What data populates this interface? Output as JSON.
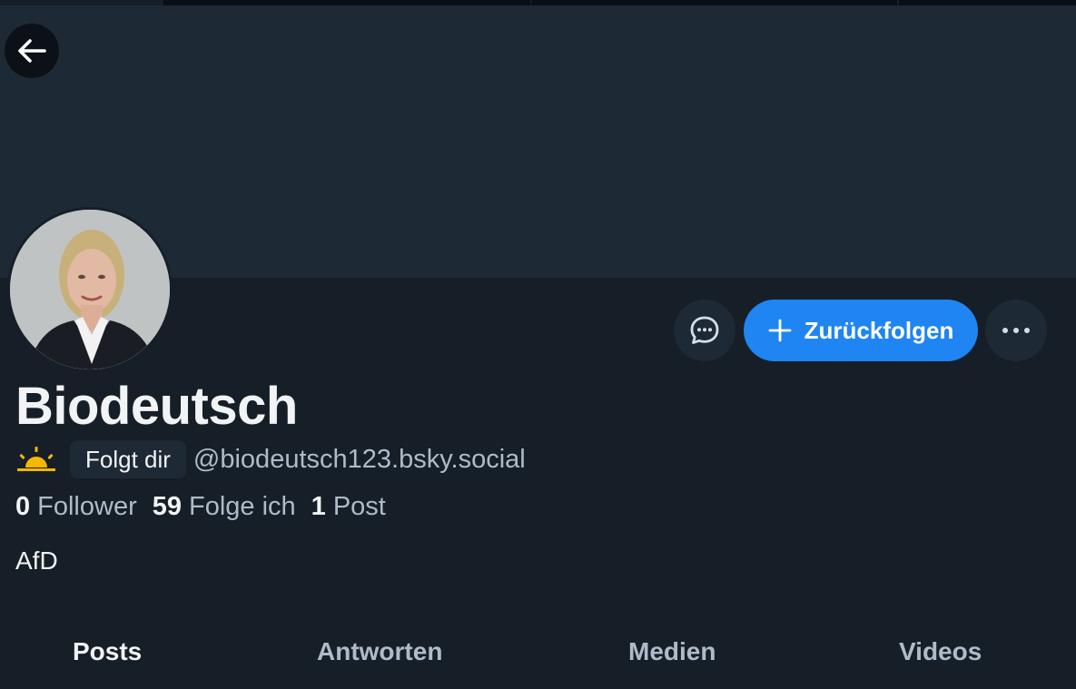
{
  "profile": {
    "display_name": "Biodeutsch",
    "handle": "@biodeutsch123.bsky.social",
    "follows_you_badge": "Folgt dir",
    "bio": "AfD"
  },
  "stats": {
    "followers_count": "0",
    "followers_label": "Follower",
    "following_count": "59",
    "following_label": "Folge ich",
    "posts_count": "1",
    "posts_label": "Post"
  },
  "actions": {
    "follow_back_label": "Zurückfolgen"
  },
  "tabs": [
    {
      "label": "Posts",
      "active": true
    },
    {
      "label": "Antworten",
      "active": false
    },
    {
      "label": "Medien",
      "active": false
    },
    {
      "label": "Videos",
      "active": false
    }
  ],
  "colors": {
    "background": "#161e27",
    "banner": "#1e2936",
    "accent": "#1f85f2",
    "muted_text": "#aebbc9",
    "sun_icon": "#f5b800"
  },
  "icons": {
    "back": "arrow-left-icon",
    "message": "chat-bubble-icon",
    "follow": "plus-icon",
    "more": "ellipsis-icon",
    "emoji": "sunrise-icon"
  }
}
